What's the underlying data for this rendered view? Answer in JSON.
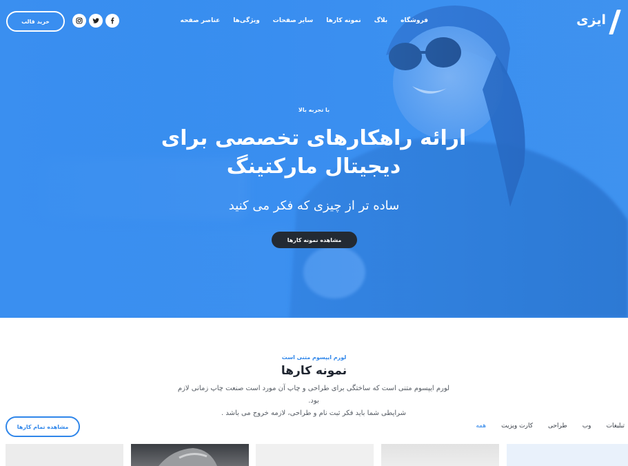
{
  "brand": {
    "logo_text": "ایزی"
  },
  "nav": {
    "items": [
      {
        "label": "عناصر صفحه"
      },
      {
        "label": "ویژگی‌ها"
      },
      {
        "label": "سایر صفحات"
      },
      {
        "label": "نمونه کارها"
      },
      {
        "label": "بلاگ"
      },
      {
        "label": "فروشگاه"
      }
    ],
    "socials": [
      "facebook-icon",
      "twitter-icon",
      "instagram-icon"
    ],
    "buy_label": "خرید قالب"
  },
  "hero": {
    "eyebrow": "با تجربه بالا",
    "title_line1": "ارائه راهکارهای تخصصی برای",
    "title_line2": "دیجیتال مارکتینگ",
    "subtitle": "ساده تر از چیزی که فکر می کنید",
    "cta_label": "مشاهده نمونه کارها"
  },
  "portfolio": {
    "eyebrow": "لورم ایپسوم متنی است",
    "title": "نمونه کارها",
    "desc_line1": "لورم ایپسوم متنی است که ساختگی برای طراحی و چاپ آن مورد است صنعت چاپ زمانی لازم بود.",
    "desc_line2": "شرایطی شما باید فکر ثبت نام و طراحی، لازمه خروج می باشد .",
    "all_label": "مشاهده تمام کارها",
    "filters": [
      {
        "label": "همه",
        "active": true
      },
      {
        "label": "کارت ویزیت",
        "active": false
      },
      {
        "label": "طراحی",
        "active": false
      },
      {
        "label": "وب",
        "active": false
      },
      {
        "label": "تبلیغات",
        "active": false
      }
    ]
  },
  "colors": {
    "hero_blue": "#2f86ea",
    "accent": "#2f86ea",
    "dark_button": "#232a33",
    "heading": "#1f2530"
  }
}
